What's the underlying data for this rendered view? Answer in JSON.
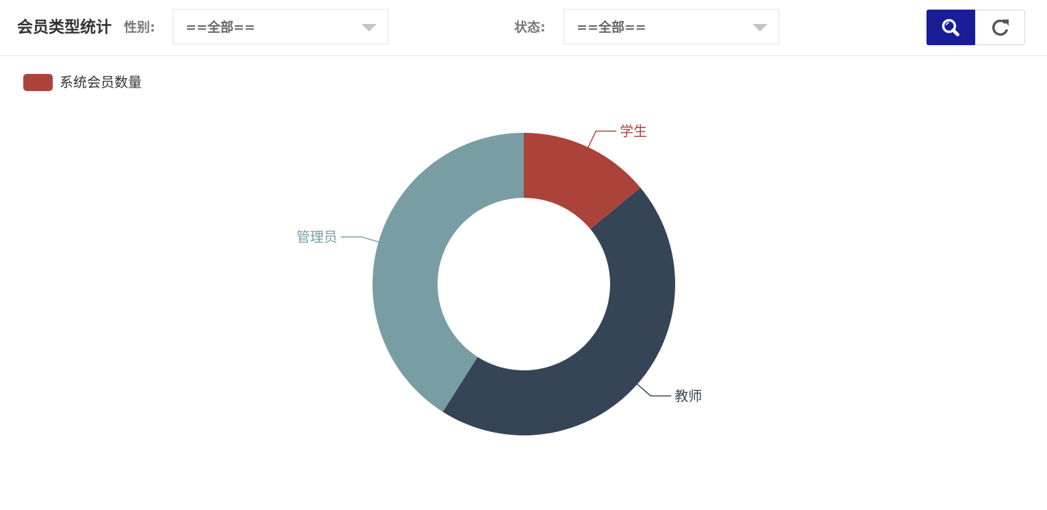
{
  "header": {
    "title": "会员类型统计",
    "gender_label": "性别:",
    "gender_value": "==全部==",
    "status_label": "状态:",
    "status_value": "==全部=="
  },
  "buttons": {
    "search_icon": "search-icon",
    "refresh_icon": "refresh-icon"
  },
  "colors": {
    "accent": "#1a1e96",
    "student": "#ac433a",
    "teacher": "#364555",
    "admin": "#789ea4"
  },
  "chart_data": {
    "type": "pie",
    "donut": true,
    "legend": [
      "系统会员数量"
    ],
    "legend_position": "top-left",
    "series": [
      {
        "name": "系统会员数量",
        "slices": [
          {
            "label": "学生",
            "value": 14,
            "color": "#ac433a"
          },
          {
            "label": "教师",
            "value": 45,
            "color": "#364555"
          },
          {
            "label": "管理员",
            "value": 41,
            "color": "#789ea4"
          }
        ]
      }
    ]
  }
}
